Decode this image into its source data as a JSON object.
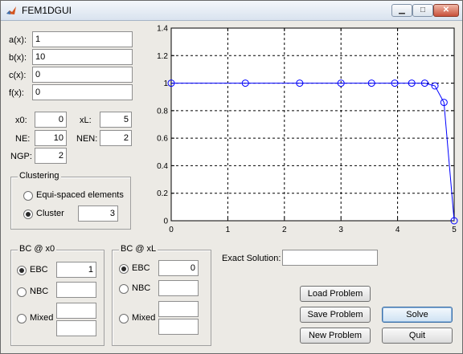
{
  "window": {
    "title": "FEM1DGUI",
    "min_glyph": "▁",
    "max_glyph": "□",
    "close_glyph": "✕"
  },
  "coeffs": [
    {
      "label": "a(x):",
      "value": "1"
    },
    {
      "label": "b(x):",
      "value": "10"
    },
    {
      "label": "c(x):",
      "value": "0"
    },
    {
      "label": "f(x):",
      "value": "0"
    }
  ],
  "params": {
    "x0_label": "x0:",
    "x0": "0",
    "xL_label": "xL:",
    "xL": "5",
    "NE_label": "NE:",
    "NE": "10",
    "NEN_label": "NEN:",
    "NEN": "2",
    "NGP_label": "NGP:",
    "NGP": "2"
  },
  "clustering": {
    "title": "Clustering",
    "equi_label": "Equi-spaced elements",
    "cluster_label": "Cluster",
    "cluster_value": "3",
    "selected": "cluster"
  },
  "bc_x0": {
    "title": "BC @ x0",
    "ebc_label": "EBC",
    "ebc_value": "1",
    "nbc_label": "NBC",
    "mixed_label": "Mixed",
    "selected": "EBC"
  },
  "bc_xL": {
    "title": "BC @ xL",
    "ebc_label": "EBC",
    "ebc_value": "0",
    "nbc_label": "NBC",
    "mixed_label": "Mixed",
    "selected": "EBC"
  },
  "exact": {
    "label": "Exact Solution:",
    "value": ""
  },
  "buttons": {
    "load": "Load Problem",
    "save": "Save Problem",
    "new": "New Problem",
    "solve": "Solve",
    "quit": "Quit"
  },
  "chart_data": {
    "type": "line",
    "title": "",
    "xlabel": "",
    "ylabel": "",
    "xlim": [
      0,
      5
    ],
    "ylim": [
      0,
      1.4
    ],
    "xticks": [
      0,
      1,
      2,
      3,
      4,
      5
    ],
    "yticks": [
      0,
      0.2,
      0.4,
      0.6,
      0.8,
      1,
      1.2,
      1.4
    ],
    "grid": true,
    "series": [
      {
        "color": "#0000ff",
        "marker": "circle",
        "x": [
          0,
          1.31,
          2.27,
          3.0,
          3.54,
          3.95,
          4.25,
          4.48,
          4.66,
          4.82,
          5.0
        ],
        "y": [
          1.0,
          1.0,
          1.0,
          1.0,
          1.0,
          1.0,
          1.0,
          1.0,
          0.98,
          0.86,
          0.0
        ]
      }
    ]
  }
}
